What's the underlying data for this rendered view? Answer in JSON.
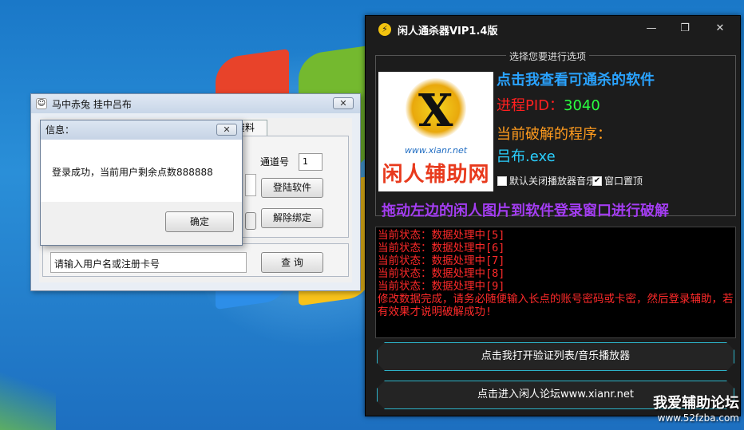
{
  "login_window": {
    "title": "马中赤兔  挂中吕布",
    "close_glyph": "✕",
    "tab_label": "资料",
    "channel_label": "通道号",
    "channel_value": "1",
    "login_button": "登陆软件",
    "unbind_button": "解除绑定",
    "user_input_value": "请输入用户名或注册卡号",
    "query_button": "查  询"
  },
  "info_dialog": {
    "title": "信息：",
    "close_glyph": "✕",
    "message": "登录成功，当前用户剩余点数888888",
    "ok_button": "确定"
  },
  "main_window": {
    "title": "闲人通杀器VIP1.4版",
    "controls": {
      "min": "—",
      "max": "❐",
      "close": "✕"
    },
    "group_legend": "选择您要进行选项",
    "logo": {
      "x_glyph": "X",
      "url": "www.xianr.net",
      "name": "闲人辅助网"
    },
    "view_link": "点击我查看可通杀的软件",
    "pid_label": "进程PID：",
    "pid_value": "3040",
    "current_label": "当前破解的程序：",
    "current_program": "吕布.exe",
    "checkbox_music": {
      "label": "默认关闭播放器音乐",
      "checked": false
    },
    "checkbox_top": {
      "label": "窗口置顶",
      "checked": true
    },
    "drag_hint": "拖动左边的闲人图片到软件登录窗口进行破解",
    "console_lines": [
      "当前状态：数据处理中[5]",
      "当前状态：数据处理中[6]",
      "当前状态：数据处理中[7]",
      "当前状态：数据处理中[8]",
      "当前状态：数据处理中[9]",
      "修改数据完成，请务必随便输入长点的账号密码或卡密，然后登录辅助，若有效果才说明破解成功!"
    ],
    "open_button": "点击我打开验证列表/音乐播放器",
    "forum_button": "点击进入闲人论坛www.xianr.net"
  },
  "watermark": {
    "name": "我爱辅助论坛",
    "url": "www.52fzba.com"
  }
}
